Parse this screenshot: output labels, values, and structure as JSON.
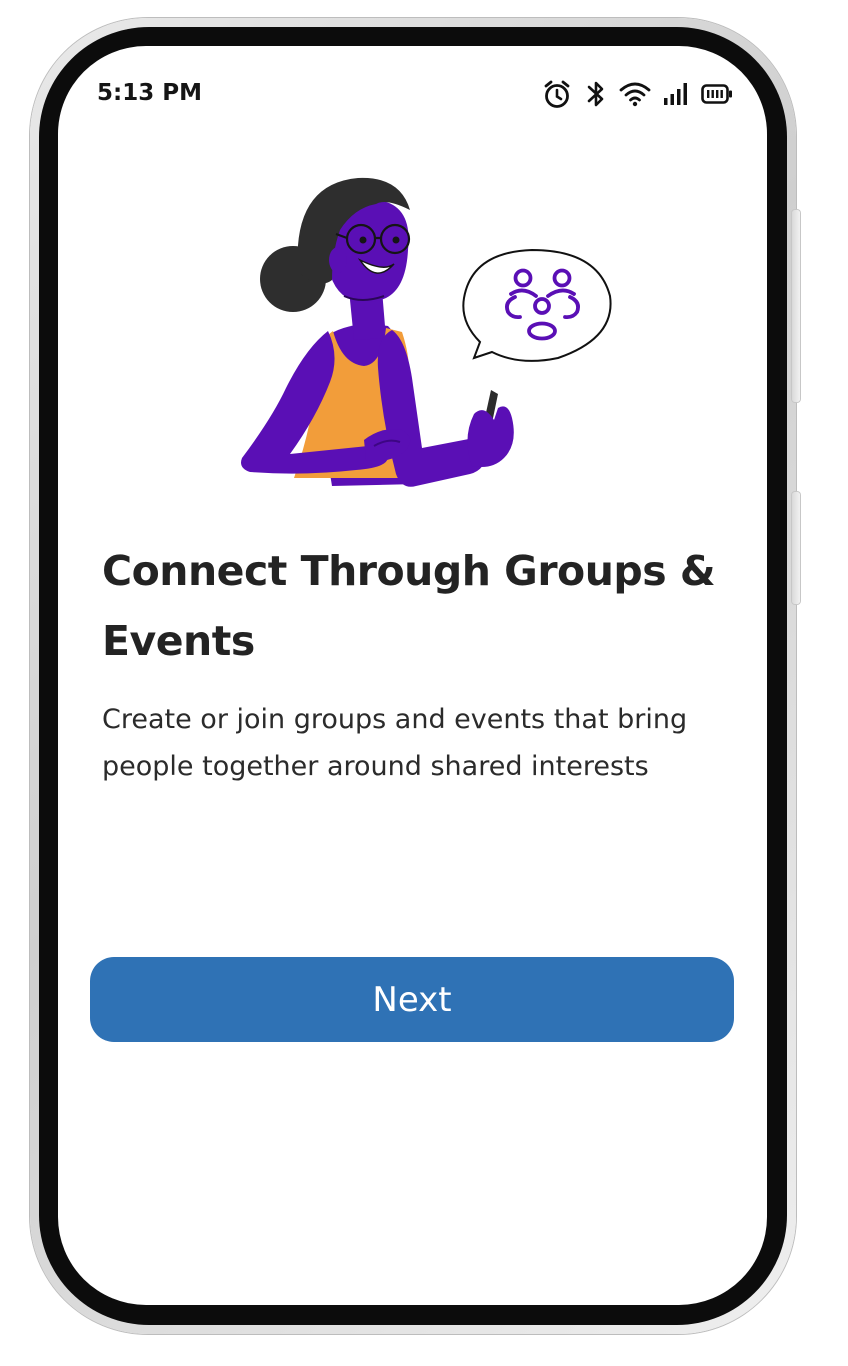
{
  "status_bar": {
    "time": "5:13 PM",
    "icons": [
      "alarm-icon",
      "bluetooth-icon",
      "wifi-icon",
      "signal-icon",
      "battery-icon"
    ]
  },
  "onboarding": {
    "title": "Connect Through Groups & Events",
    "description": "Create or join groups and events that bring people together around shared interests",
    "illustration": "woman-holding-phone-with-group-speech-bubble"
  },
  "actions": {
    "next_label": "Next"
  },
  "colors": {
    "primary_button": "#2f72b5",
    "illustration_purple": "#5a0fb5",
    "illustration_orange": "#f29d3a",
    "title_text": "#232323",
    "screen_background": "#ffffff"
  }
}
